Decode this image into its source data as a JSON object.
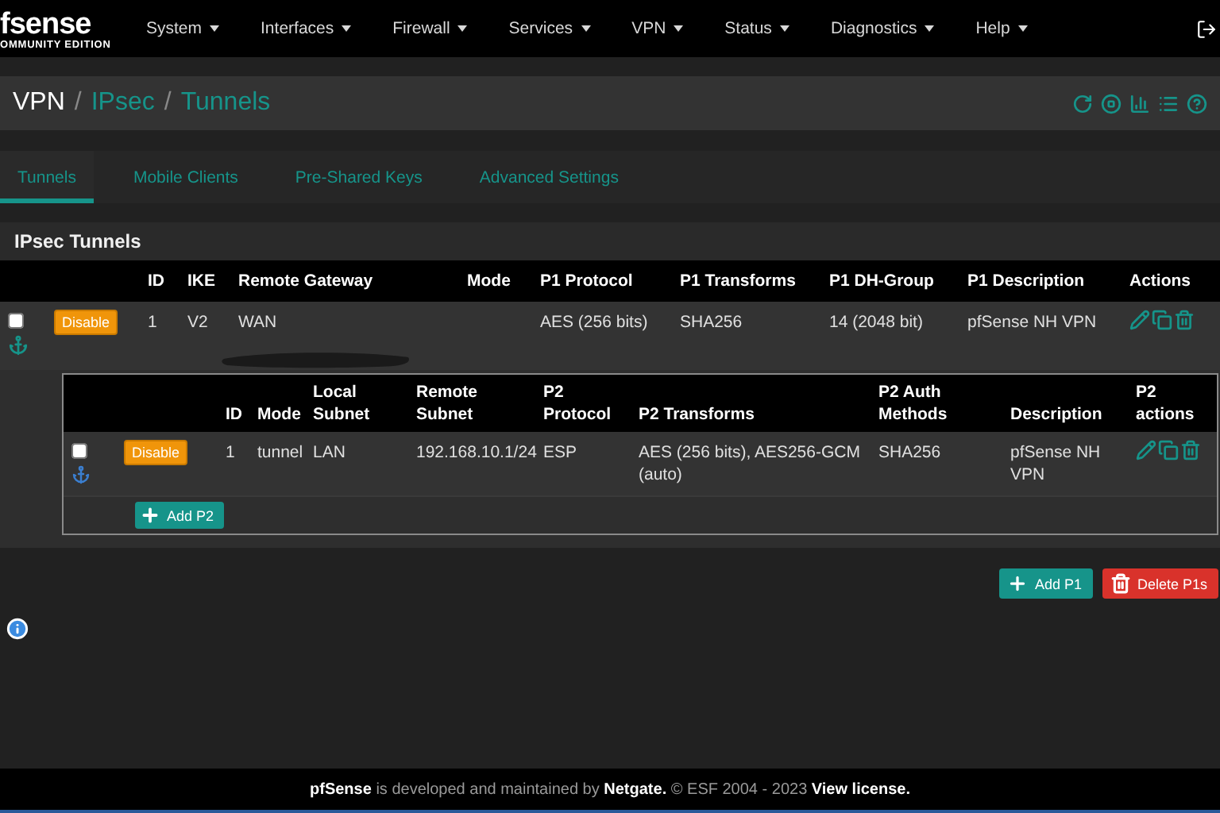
{
  "brand": {
    "name": "fsense",
    "edition": "OMMUNITY EDITION"
  },
  "nav": [
    "System",
    "Interfaces",
    "Firewall",
    "Services",
    "VPN",
    "Status",
    "Diagnostics",
    "Help"
  ],
  "breadcrumb": [
    {
      "label": "VPN",
      "kind": "plain"
    },
    {
      "label": "/",
      "kind": "separator"
    },
    {
      "label": "IPsec",
      "kind": "link"
    },
    {
      "label": "/",
      "kind": "separator"
    },
    {
      "label": "Tunnels",
      "kind": "link"
    }
  ],
  "tabs": [
    {
      "label": "Tunnels",
      "selected": true
    },
    {
      "label": "Mobile Clients",
      "selected": false
    },
    {
      "label": "Pre-Shared Keys",
      "selected": false
    },
    {
      "label": "Advanced Settings",
      "selected": false
    }
  ],
  "panel": {
    "title": "IPsec Tunnels",
    "columns": [
      "ID",
      "IKE",
      "Remote Gateway",
      "Mode",
      "P1 Protocol",
      "P1 Transforms",
      "P1 DH-Group",
      "P1 Description",
      "Actions"
    ],
    "rows": [
      {
        "checked": false,
        "toggle": "Disable",
        "id": "1",
        "ike": "V2",
        "gateway": "WAN",
        "p1_protocol": "AES (256 bits)",
        "p1_transforms": "SHA256",
        "dh_group": "14 (2048 bit)",
        "description": "pfSense NH VPN"
      }
    ],
    "phase2": {
      "columns": [
        "ID",
        "Mode",
        "Local\nSubnet",
        "Remote Subnet",
        "P2\nProtocol",
        "P2 Transforms",
        "P2 Auth\nMethods",
        "Description",
        "P2\nactions"
      ],
      "rows": [
        {
          "checked": false,
          "toggle": "Disable",
          "id": "1",
          "mode": "tunnel",
          "local_subnet": "LAN",
          "remote_subnet": "192.168.10.1/24",
          "protocol": "ESP",
          "transforms": "AES (256 bits), AES256-GCM (auto)",
          "auth": "SHA256",
          "description": "pfSense NH VPN"
        }
      ],
      "add_button": "Add P2"
    }
  },
  "buttons": [
    {
      "kind": "add",
      "label": "Add P1"
    },
    {
      "kind": "delete",
      "label": "Delete P1s"
    }
  ],
  "footer": "**pfSense** is developed and maintained by **Netgate.** © ESF 2004 - 2023 **View license.**"
}
